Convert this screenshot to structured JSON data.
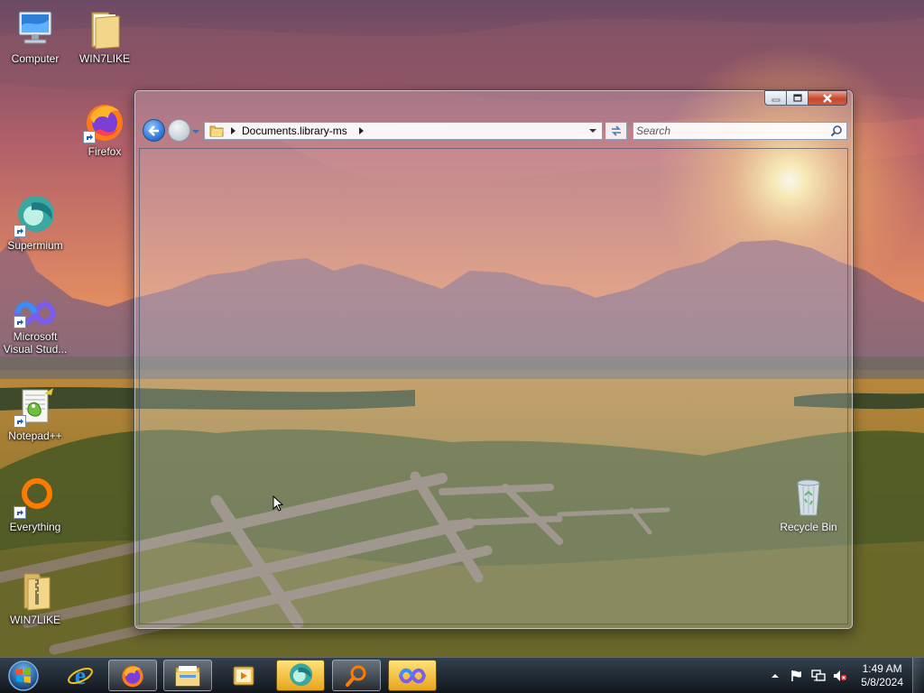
{
  "desktop": {
    "icons": [
      {
        "label": "Computer",
        "icon": "computer-icon"
      },
      {
        "label": "WIN7LIKE",
        "icon": "folder-icon"
      },
      {
        "label": "Firefox",
        "icon": "firefox-icon"
      },
      {
        "label": "Supermium",
        "icon": "supermium-icon"
      },
      {
        "label": "Microsoft Visual Stud...",
        "icon": "visual-studio-icon"
      },
      {
        "label": "Notepad++",
        "icon": "notepadpp-icon"
      },
      {
        "label": "Everything",
        "icon": "everything-icon"
      },
      {
        "label": "WIN7LIKE",
        "icon": "zip-folder-icon"
      },
      {
        "label": "Recycle Bin",
        "icon": "recycle-bin-icon"
      }
    ]
  },
  "window": {
    "address": {
      "crumbs": [
        "Documents.library-ms"
      ]
    },
    "search": {
      "placeholder": "Search"
    }
  },
  "taskbar": {
    "start": "start-orb-icon",
    "items": [
      {
        "icon": "internet-explorer-icon",
        "state": "plain"
      },
      {
        "icon": "firefox-icon",
        "state": "pinned"
      },
      {
        "icon": "file-explorer-icon",
        "state": "pinned"
      },
      {
        "icon": "media-player-icon",
        "state": "plain"
      },
      {
        "icon": "supermium-icon",
        "state": "active"
      },
      {
        "icon": "everything-icon",
        "state": "pinned"
      },
      {
        "icon": "visual-studio-icon",
        "state": "active"
      }
    ],
    "tray": {
      "icons": [
        "show-hidden-icons",
        "action-center-flag-icon",
        "network-icon",
        "volume-muted-icon"
      ],
      "time": "1:49 AM",
      "date": "5/8/2024"
    }
  },
  "colors": {
    "taskbar_active": "#f0b432",
    "close_button": "#c7472d",
    "nav_back": "#2a6fd1"
  }
}
